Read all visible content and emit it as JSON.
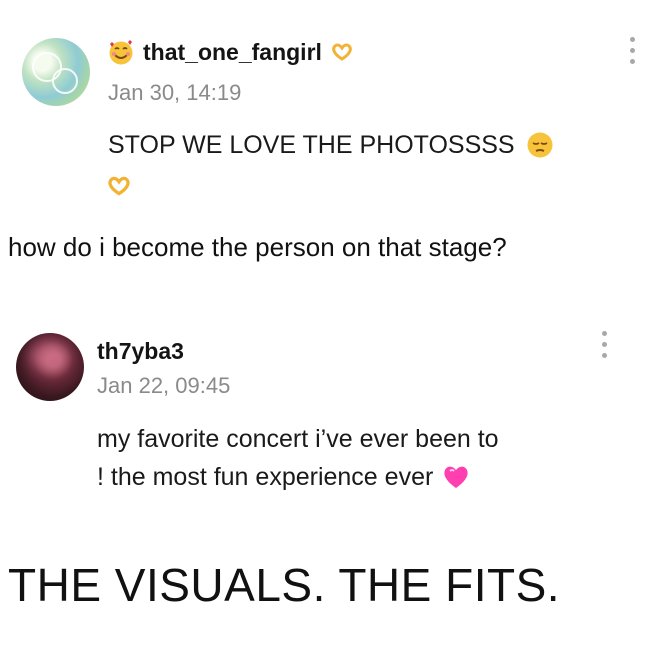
{
  "comment1": {
    "username": "that_one_fangirl",
    "timestamp": "Jan 30, 14:19",
    "text": "STOP WE LOVE THE PHOTOSSSS",
    "emojis": [
      "smiling-face-with-hearts-icon",
      "heart-hands-icon",
      "pensive-face-icon"
    ]
  },
  "caption1": "how do i become the person on that stage?",
  "comment2": {
    "username": "th7yba3",
    "timestamp": "Jan 22, 09:45",
    "text_line1": "my favorite concert i’ve ever been to",
    "text_line2": "! the most fun experience ever",
    "emojis": [
      "pink-heart-icon"
    ]
  },
  "caption2": "THE VISUALS. THE FITS.",
  "colors": {
    "text": "#141414",
    "muted": "#8a8a8a",
    "kebab": "#a8a8a8",
    "heart_hands": "#f2b233",
    "pink_heart": "#ff3fb0"
  }
}
